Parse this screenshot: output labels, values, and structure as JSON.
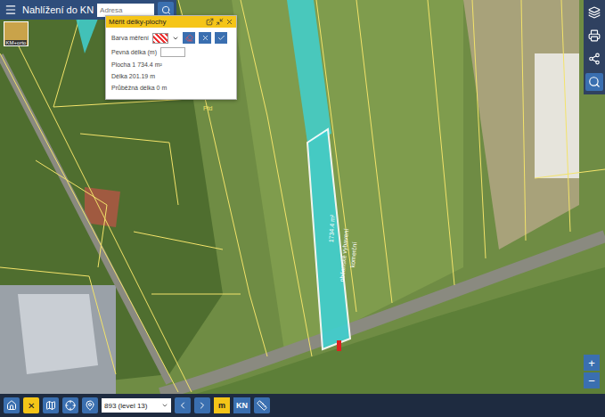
{
  "header": {
    "menu_icon": "☰",
    "title": "Nahlížení do KN",
    "search": {
      "placeholder": "Adresa"
    }
  },
  "layer_thumbnail": {
    "label": "KM+orto"
  },
  "measure_panel": {
    "title": "Měřit délky-plochy",
    "color_label": "Barva měření",
    "fixed_length_label": "Pevná délka (m)",
    "fixed_length_value": "",
    "area": "Plocha 1 734.4 m²",
    "length": "Délka 201.19 m",
    "running_length": "Průběžná délka 0 m"
  },
  "map": {
    "labels": [
      "Ptd",
      "1734.4 m²",
      "občanské vybavení",
      "komerční"
    ]
  },
  "zoom": [
    "+",
    "−"
  ],
  "bottom_bar": {
    "close_icon": "✕",
    "level_select": "893 (level 13)",
    "measure_button": "m",
    "kn_button": "KN"
  }
}
